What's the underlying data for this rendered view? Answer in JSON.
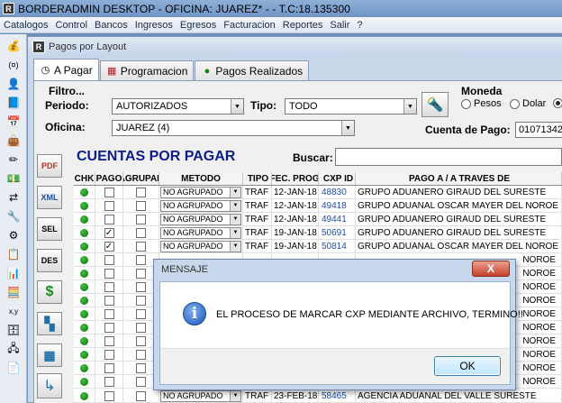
{
  "window": {
    "title": "BORDERADMIN DESKTOP - OFICINA: JUAREZ* -   - T.C:18.135300",
    "icon_letter": "R"
  },
  "menu": [
    "Catalogos",
    "Control",
    "Bancos",
    "Ingresos",
    "Egresos",
    "Facturacion",
    "Reportes",
    "Salir",
    "?"
  ],
  "child": {
    "title": "Pagos por Layout",
    "icon_letter": "R",
    "tabs": [
      "A Pagar",
      "Programacion",
      "Pagos Realizados"
    ]
  },
  "filters": {
    "group_label": "Filtro...",
    "periodo_label": "Periodo:",
    "periodo_value": "AUTORIZADOS",
    "tipo_label": "Tipo:",
    "tipo_value": "TODO",
    "oficina_label": "Oficina:",
    "oficina_value": "JUAREZ (4)",
    "moneda_label": "Moneda",
    "moneda_options": [
      "Pesos",
      "Dolar"
    ],
    "cuenta_label": "Cuenta de Pago:",
    "cuenta_value": "01071342"
  },
  "side_buttons": [
    "PDF",
    "XML",
    "SEL",
    "DES",
    "$",
    "",
    ""
  ],
  "section_title": "CUENTAS POR PAGAR",
  "buscar_label": "Buscar:",
  "table": {
    "headers": [
      "CHK",
      "PAGO",
      "AGRUPAR",
      "METODO",
      "TIPO",
      "FEC. PROG.",
      "CXP ID",
      "PAGO A / A TRAVES DE"
    ],
    "rows": [
      {
        "pago": false,
        "metodo": "NO AGRUPADO",
        "tipo": "TRAF",
        "fecha": "12-JAN-18",
        "cxp": "48830",
        "pago_a": "GRUPO ADUANERO GIRAUD DEL SURESTE"
      },
      {
        "pago": false,
        "metodo": "NO AGRUPADO",
        "tipo": "TRAF",
        "fecha": "12-JAN-18",
        "cxp": "49418",
        "pago_a": "GRUPO ADUANAL OSCAR MAYER DEL NOROE"
      },
      {
        "pago": false,
        "metodo": "NO AGRUPADO",
        "tipo": "TRAF",
        "fecha": "12-JAN-18",
        "cxp": "49441",
        "pago_a": "GRUPO ADUANERO GIRAUD DEL SURESTE"
      },
      {
        "pago": true,
        "metodo": "NO AGRUPADO",
        "tipo": "TRAF",
        "fecha": "19-JAN-18",
        "cxp": "50691",
        "pago_a": "GRUPO ADUANERO GIRAUD DEL SURESTE"
      },
      {
        "pago": true,
        "metodo": "NO AGRUPADO",
        "tipo": "TRAF",
        "fecha": "19-JAN-18",
        "cxp": "50814",
        "pago_a": "GRUPO ADUANAL OSCAR MAYER DEL NOROE"
      }
    ],
    "partial_right": [
      "NOROE",
      "NOROE",
      "NOROE",
      "NOROE",
      "NOROE",
      "NOROE",
      "NOROE",
      "NOROE",
      "NOROE",
      "NOROE"
    ],
    "bottom_row": {
      "metodo": "NO AGRUPADO",
      "tipo": "TRAF",
      "fecha": "23-FEB-18",
      "cxp": "58465",
      "pago_a": "AGENCIA ADUANAL DEL VALLE SURESTE"
    }
  },
  "modal": {
    "title": "MENSAJE",
    "close": "X",
    "message": "EL PROCESO DE MARCAR CXP MEDIANTE ARCHIVO, TERMINO!!",
    "ok": "OK"
  }
}
